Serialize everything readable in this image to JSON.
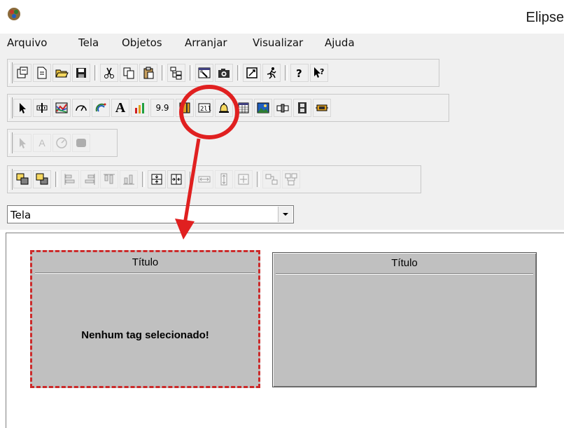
{
  "window": {
    "title": "Elipse"
  },
  "menu": {
    "items": [
      "Arquivo",
      "Tela",
      "Objetos",
      "Arranjar",
      "Visualizar",
      "Ajuda"
    ]
  },
  "toolbar_objects": {
    "display_value": "9.9",
    "text_tool_label": "A"
  },
  "toolbar_disabled": {
    "text_tool_label": "A"
  },
  "screen_selector": {
    "selected": "Tela"
  },
  "panels": [
    {
      "title": "Título",
      "message": "Nenhum tag selecionado!"
    },
    {
      "title": "Título",
      "message": ""
    }
  ],
  "annotation": {
    "color": "#e02020"
  },
  "colors": {
    "panel_bg": "#c0c0c0",
    "selection_border": "#cc2a2a",
    "chrome_bg": "#f0f0f0"
  }
}
